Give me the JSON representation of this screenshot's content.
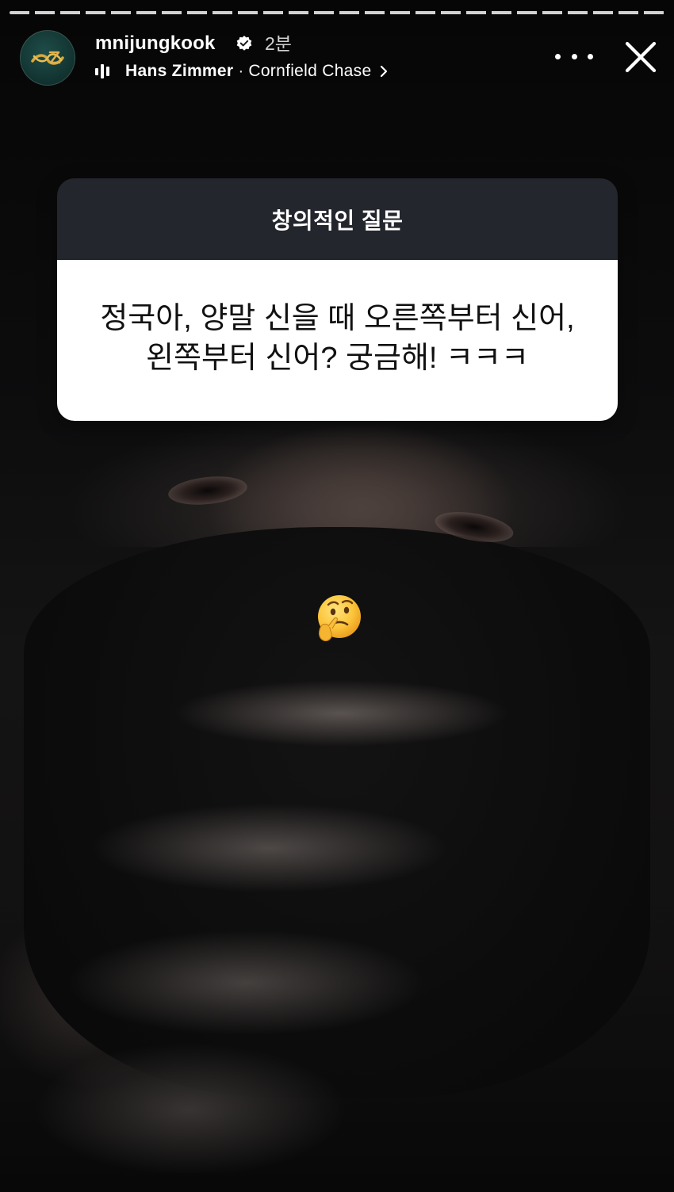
{
  "story": {
    "progress_segments": 1,
    "header": {
      "username": "mnijungkook",
      "verified": true,
      "time_ago": "2분",
      "music": {
        "artist": "Hans Zimmer",
        "separator": "·",
        "track": "Cornfield Chase"
      },
      "icons": {
        "avatar": "profile-avatar",
        "verified": "verified-badge-icon",
        "music": "music-bars-icon",
        "chevron": "chevron-right-icon",
        "more": "more-options-icon",
        "close": "close-icon"
      }
    },
    "question_card": {
      "title": "창의적인 질문",
      "lines": [
        "정국아, 양말 신을 때 오른쪽부터 신어,",
        "왼쪽부터 신어? 궁금해! ㅋㅋㅋ"
      ]
    },
    "sticker": {
      "emoji": "thinking-face-emoji"
    },
    "colors": {
      "card_header": "#24262d",
      "card_body": "#ffffff",
      "avatar_bg": "#143835",
      "avatar_logo": "#d9a83a"
    }
  }
}
